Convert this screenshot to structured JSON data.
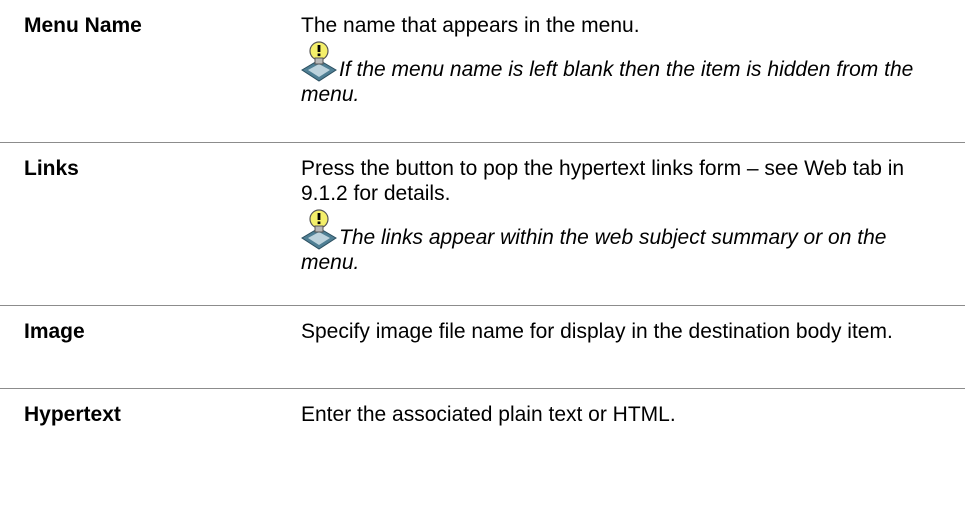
{
  "rows": [
    {
      "term": "Menu Name",
      "description": "The name that appears in the menu.",
      "note": "If the menu name is left blank then the item is hidden from the menu.",
      "note_icon": "lightbulb-tip-icon"
    },
    {
      "term": "Links",
      "description": "Press the button to pop the hypertext links form – see Web tab in 9.1.2 for details.",
      "note": "The links appear within the web subject  summary or on the menu.",
      "note_icon": "lightbulb-tip-icon"
    },
    {
      "term": "Image",
      "description": "Specify image file name for display in the destination body item."
    },
    {
      "term": "Hypertext",
      "description": "Enter the associated plain text or HTML."
    }
  ]
}
